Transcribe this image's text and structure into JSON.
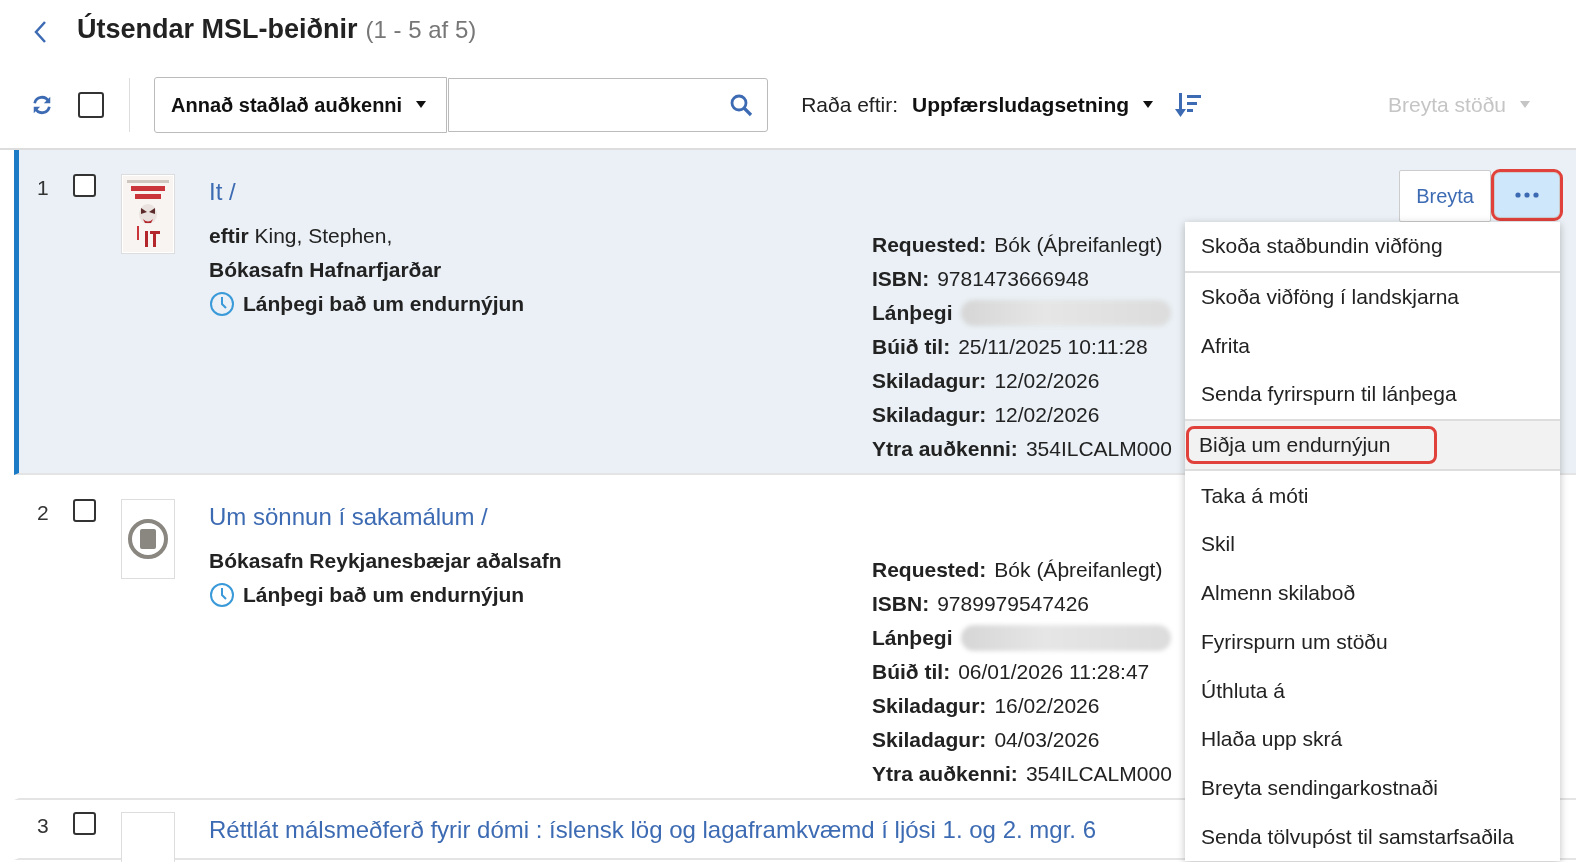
{
  "header": {
    "title": "Útsendar MSL-beiðnir",
    "count": "(1 - 5 af 5)"
  },
  "toolbar": {
    "select_all": {
      "checked": false
    },
    "search_type": "Annað staðlað auðkenni",
    "sort_label": "Raða eftir:",
    "sort_value": "Uppfærsludagsetning",
    "bulk_action": {
      "label": "Breyta stöðu",
      "disabled": true
    }
  },
  "rows": [
    {
      "number": "1",
      "checked": false,
      "selected": true,
      "thumbnail": {
        "kind": "cover"
      },
      "title": "It /",
      "author_label": "eftir",
      "author": "King, Stephen,",
      "library": "Bókasafn Hafnarfjarðar",
      "status": "Lánþegi bað um endurnýjun",
      "details": [
        {
          "kind": "text",
          "label": "Requested:",
          "value": "Bók (Áþreifanlegt)"
        },
        {
          "kind": "text",
          "label": "ISBN:",
          "value": "9781473666948"
        },
        {
          "kind": "redacted",
          "label": "Lánþegi"
        },
        {
          "kind": "text",
          "label": "Búið til:",
          "value": "25/11/2025 10:11:28"
        },
        {
          "kind": "text",
          "label": "Skiladagur:",
          "value": "12/02/2026"
        },
        {
          "kind": "text",
          "label": "Skiladagur:",
          "value": "12/02/2026"
        },
        {
          "kind": "text",
          "label": "Ytra auðkenni:",
          "value": "354ILCALM000"
        }
      ],
      "actions": {
        "edit": "Breyta",
        "more": {
          "open": true,
          "highlighted": true
        }
      }
    },
    {
      "number": "2",
      "checked": false,
      "selected": false,
      "thumbnail": {
        "kind": "generic"
      },
      "title": "Um sönnun í sakamálum /",
      "library": "Bókasafn Reykjanesbæjar aðalsafn",
      "status": "Lánþegi bað um endurnýjun",
      "details": [
        {
          "kind": "text",
          "label": "Requested:",
          "value": "Bók (Áþreifanlegt)"
        },
        {
          "kind": "text",
          "label": "ISBN:",
          "value": "9789979547426"
        },
        {
          "kind": "redacted",
          "label": "Lánþegi"
        },
        {
          "kind": "text",
          "label": "Búið til:",
          "value": "06/01/2026 11:28:47"
        },
        {
          "kind": "text",
          "label": "Skiladagur:",
          "value": "16/02/2026"
        },
        {
          "kind": "text",
          "label": "Skiladagur:",
          "value": "04/03/2026"
        },
        {
          "kind": "text",
          "label": "Ytra auðkenni:",
          "value": "354ILCALM000"
        }
      ]
    },
    {
      "number": "3",
      "checked": false,
      "selected": false,
      "thumbnail": {
        "kind": "empty"
      },
      "title": "Réttlát málsmeðferð fyrir dómi : íslensk lög og lagaframkvæmd í ljósi 1. og 2. mgr. 6"
    }
  ],
  "menu": {
    "groups": [
      [
        {
          "label": "Skoða staðbundin viðföng",
          "selected": false,
          "highlighted": false
        }
      ],
      [
        {
          "label": "Skoða viðföng í landskjarna",
          "selected": false,
          "highlighted": false
        },
        {
          "label": "Afrita",
          "selected": false,
          "highlighted": false
        },
        {
          "label": "Senda fyrirspurn til lánþega",
          "selected": false,
          "highlighted": false
        }
      ],
      [
        {
          "label": "Biðja um endurnýjun",
          "selected": true,
          "highlighted": true
        }
      ],
      [
        {
          "label": "Taka á móti",
          "selected": false,
          "highlighted": false
        },
        {
          "label": "Skil",
          "selected": false,
          "highlighted": false
        },
        {
          "label": "Almenn skilaboð",
          "selected": false,
          "highlighted": false
        },
        {
          "label": "Fyrirspurn um stöðu",
          "selected": false,
          "highlighted": false
        },
        {
          "label": "Úthluta á",
          "selected": false,
          "highlighted": false
        },
        {
          "label": "Hlaða upp skrá",
          "selected": false,
          "highlighted": false
        },
        {
          "label": "Breyta sendingarkostnaði",
          "selected": false,
          "highlighted": false
        },
        {
          "label": "Senda tölvupóst til samstarfsaðila",
          "selected": false,
          "highlighted": false
        }
      ]
    ]
  }
}
